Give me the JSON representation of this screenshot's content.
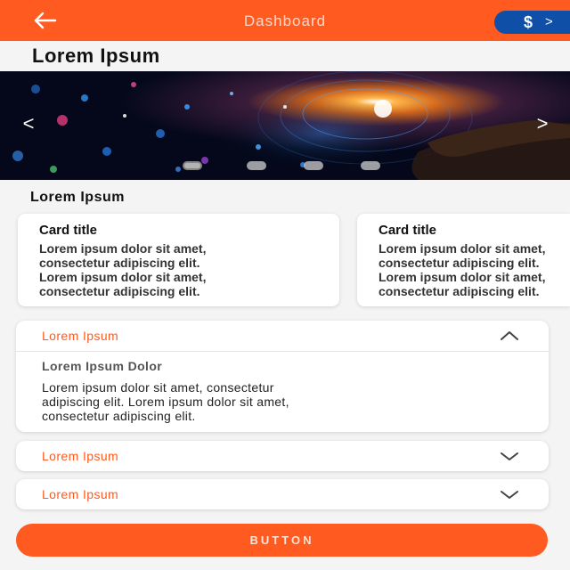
{
  "header": {
    "title": "Dashboard",
    "back_icon": "arrow-left-icon",
    "coin_icon": "dollar-coin-icon",
    "coin_arrow": ">",
    "accent_color": "#ff5a1f",
    "pill_color": "#0f4fa8"
  },
  "page": {
    "title": "Lorem Ipsum"
  },
  "carousel": {
    "prev_label": "<",
    "next_label": ">",
    "slide_count": 4,
    "active_slide": 1
  },
  "section": {
    "title": "Lorem Ipsum"
  },
  "cards": [
    {
      "title": "Card title",
      "lines": [
        "Lorem ipsum dolor sit amet,",
        "consectetur adipiscing elit.",
        "Lorem ipsum dolor sit amet,",
        "consectetur adipiscing elit."
      ]
    },
    {
      "title": "Card title",
      "lines": [
        "Lorem ipsum dolor sit amet,",
        "consectetur adipiscing elit.",
        "Lorem ipsum dolor sit amet,",
        "consectetur adipiscing elit."
      ]
    }
  ],
  "accordion": [
    {
      "label": "Lorem Ipsum",
      "expanded": true,
      "subtitle": "Lorem Ipsum Dolor",
      "lines": [
        "Lorem ipsum dolor sit amet, consectetur",
        "adipiscing elit. Lorem ipsum dolor sit amet,",
        "consectetur adipiscing elit."
      ]
    },
    {
      "label": "Lorem Ipsum",
      "expanded": false
    },
    {
      "label": "Lorem Ipsum",
      "expanded": false
    }
  ],
  "button": {
    "label": "BUTTON"
  }
}
